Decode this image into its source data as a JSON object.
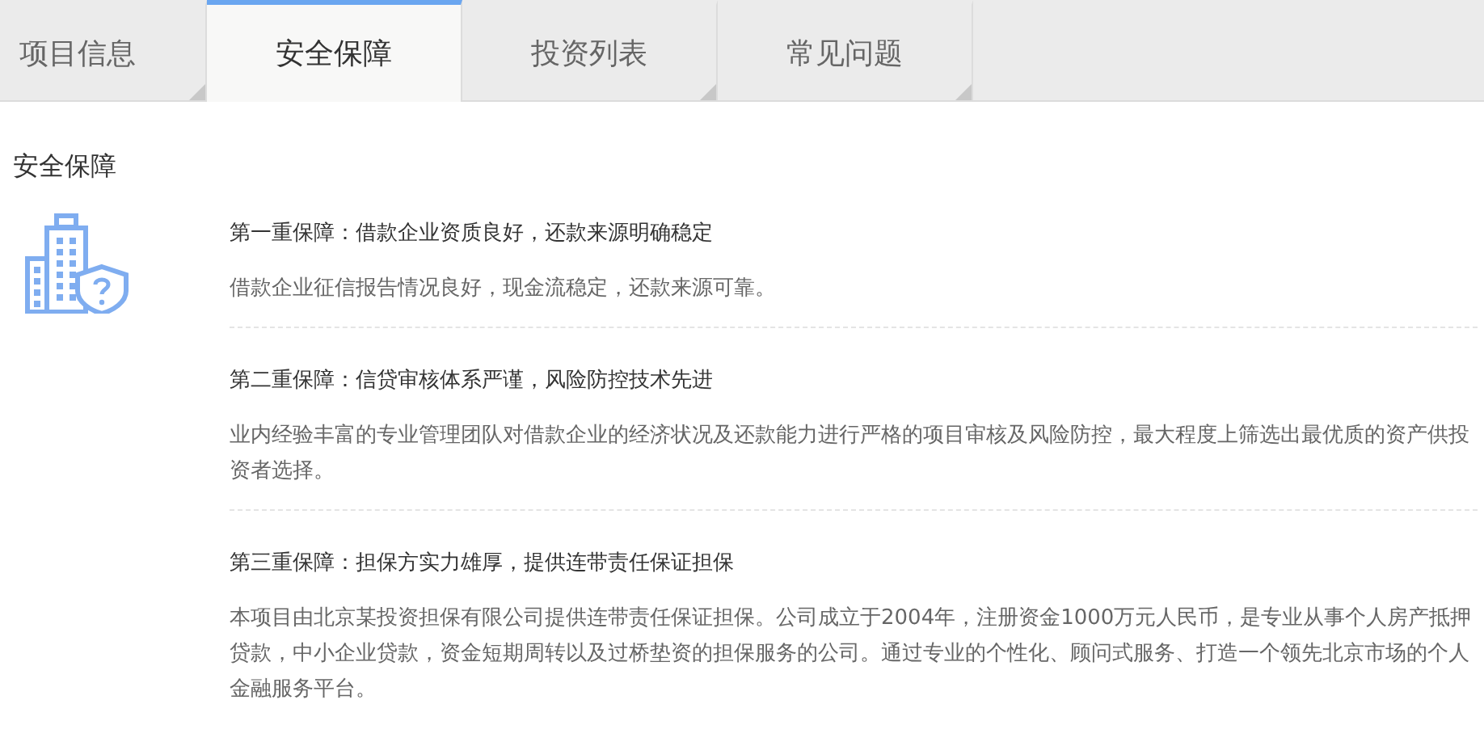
{
  "tabs": [
    {
      "label": "项目信息",
      "selected": false
    },
    {
      "label": "安全保障",
      "selected": true
    },
    {
      "label": "投资列表",
      "selected": false
    },
    {
      "label": "常见问题",
      "selected": false
    }
  ],
  "section_title": "安全保障",
  "guarantees": [
    {
      "title": "第一重保障：借款企业资质良好，还款来源明确稳定",
      "text": "借款企业征信报告情况良好，现金流稳定，还款来源可靠。"
    },
    {
      "title": "第二重保障：信贷审核体系严谨，风险防控技术先进",
      "text": "业内经验丰富的专业管理团队对借款企业的经济状况及还款能力进行严格的项目审核及风险防控，最大程度上筛选出最优质的资产供投资者选择。"
    },
    {
      "title": "第三重保障：担保方实力雄厚，提供连带责任保证担保",
      "text": "本项目由北京某投资担保有限公司提供连带责任保证担保。公司成立于2004年，注册资金1000万元人民币，是专业从事个人房产抵押贷款，中小企业贷款，资金短期周转以及过桥垫资的担保服务的公司。通过专业的个性化、顾问式服务、打造一个领先北京市场的个人金融服务平台。"
    }
  ]
}
